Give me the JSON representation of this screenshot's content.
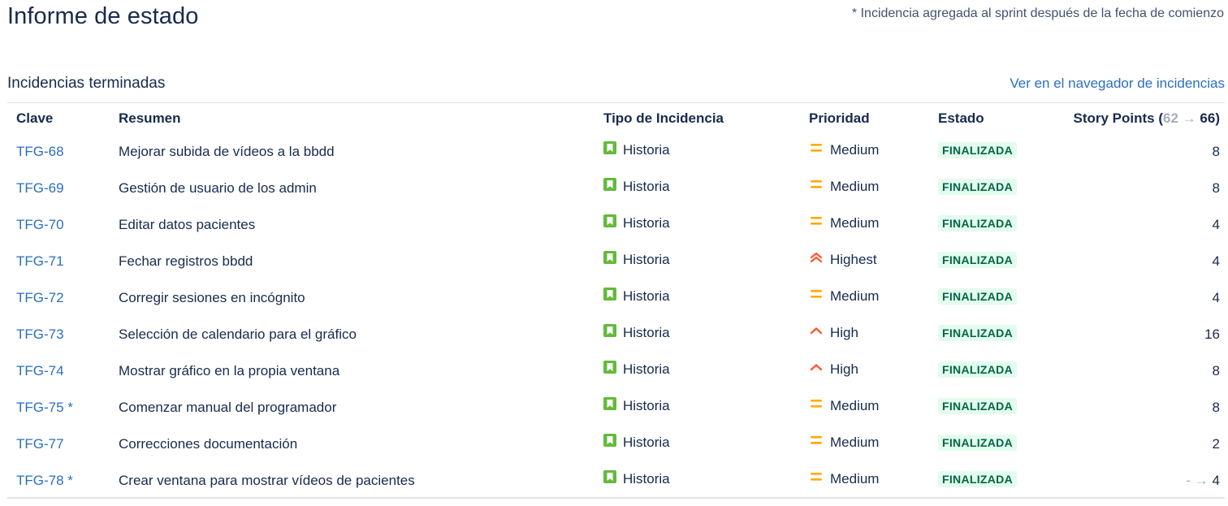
{
  "header": {
    "title": "Informe de estado",
    "note": "* Incidencia agregada al sprint después de la fecha de comienzo"
  },
  "section": {
    "title": "Incidencias terminadas",
    "link_label": "Ver en el navegador de incidencias"
  },
  "table": {
    "columns": {
      "key": "Clave",
      "summary": "Resumen",
      "type": "Tipo de Incidencia",
      "priority": "Prioridad",
      "status": "Estado",
      "story_points": "Story Points",
      "sp_old": "62",
      "sp_arrow": "→",
      "sp_new": "66"
    },
    "rows": [
      {
        "key": "TFG-68",
        "star": "",
        "summary": "Mejorar subida de vídeos a la bbdd",
        "type": "Historia",
        "priority": "Medium",
        "status": "FINALIZADA",
        "sp_prefix": "",
        "sp": "8"
      },
      {
        "key": "TFG-69",
        "star": "",
        "summary": "Gestión de usuario de los admin",
        "type": "Historia",
        "priority": "Medium",
        "status": "FINALIZADA",
        "sp_prefix": "",
        "sp": "8"
      },
      {
        "key": "TFG-70",
        "star": "",
        "summary": "Editar datos pacientes",
        "type": "Historia",
        "priority": "Medium",
        "status": "FINALIZADA",
        "sp_prefix": "",
        "sp": "4"
      },
      {
        "key": "TFG-71",
        "star": "",
        "summary": "Fechar registros bbdd",
        "type": "Historia",
        "priority": "Highest",
        "status": "FINALIZADA",
        "sp_prefix": "",
        "sp": "4"
      },
      {
        "key": "TFG-72",
        "star": "",
        "summary": "Corregir sesiones en incógnito",
        "type": "Historia",
        "priority": "Medium",
        "status": "FINALIZADA",
        "sp_prefix": "",
        "sp": "4"
      },
      {
        "key": "TFG-73",
        "star": "",
        "summary": "Selección de calendario para el gráfico",
        "type": "Historia",
        "priority": "High",
        "status": "FINALIZADA",
        "sp_prefix": "",
        "sp": "16"
      },
      {
        "key": "TFG-74",
        "star": "",
        "summary": "Mostrar gráfico en la propia ventana",
        "type": "Historia",
        "priority": "High",
        "status": "FINALIZADA",
        "sp_prefix": "",
        "sp": "8"
      },
      {
        "key": "TFG-75",
        "star": "*",
        "summary": "Comenzar manual del programador",
        "type": "Historia",
        "priority": "Medium",
        "status": "FINALIZADA",
        "sp_prefix": "",
        "sp": "8"
      },
      {
        "key": "TFG-77",
        "star": "",
        "summary": "Correcciones documentación",
        "type": "Historia",
        "priority": "Medium",
        "status": "FINALIZADA",
        "sp_prefix": "",
        "sp": "2"
      },
      {
        "key": "TFG-78",
        "star": "*",
        "summary": "Crear ventana para mostrar vídeos de pacientes",
        "type": "Historia",
        "priority": "Medium",
        "status": "FINALIZADA",
        "sp_prefix": "- →",
        "sp": "4"
      }
    ]
  },
  "colors": {
    "link": "#2a6fbf",
    "story_icon": "#63ba3c",
    "priority_medium": "#ffab00",
    "priority_high": "#ff5630",
    "status_done_bg": "#e3fcef",
    "status_done_text": "#006644"
  },
  "icons": {
    "type_story": "bookmark-icon",
    "priority_medium": "equals-icon",
    "priority_high": "chevron-up-icon",
    "priority_highest": "double-chevron-up-icon"
  }
}
